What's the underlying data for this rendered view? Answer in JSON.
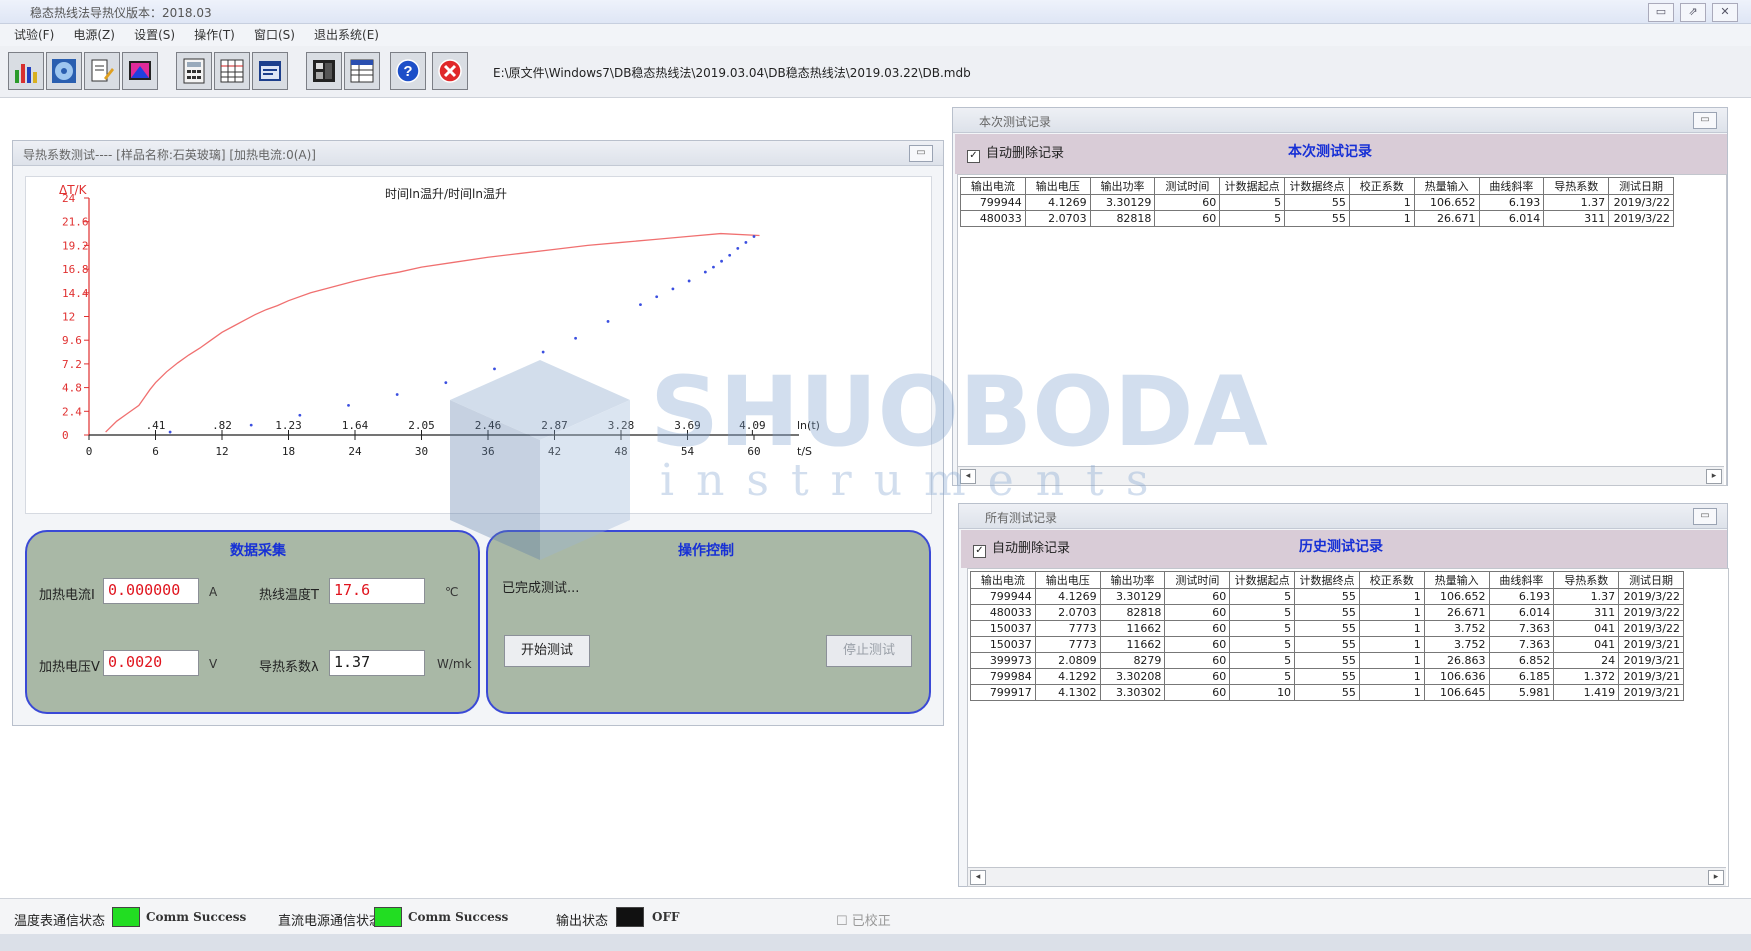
{
  "window": {
    "title": "稳态热线法导热仪版本：2018.03",
    "controls": [
      "▭",
      "⇗",
      "✕"
    ]
  },
  "menu": {
    "items": [
      "试验(F)",
      "电源(Z)",
      "设置(S)",
      "操作(T)",
      "窗口(S)",
      "退出系统(E)"
    ]
  },
  "toolbar": {
    "icons": [
      "chart-bars-icon",
      "disc-icon",
      "edit-report-icon",
      "monitor-icon",
      "calculator-icon",
      "grid-table-icon",
      "data-window-icon",
      "display-panel-icon",
      "table-window-icon",
      "help-icon",
      "close-icon"
    ],
    "path": "E:\\原文件\\Windows7\\DB稳态热线法\\2019.03.04\\DB稳态热线法\\2019.03.22\\DB.mdb",
    "help_label": "?"
  },
  "test_panel": {
    "title": "导热系数测试---- [样品名称:石英玻璃]  [加热电流:0(A)]",
    "chart_title": "时间ln温升/时间ln温升",
    "y_label": "ΔT/K",
    "x_label": "t/S",
    "lnx_label": "ln(t)",
    "collect": {
      "title": "数据采集",
      "current_label": "加热电流I",
      "current_value": "0.000000",
      "current_unit": "A",
      "voltage_label": "加热电压V",
      "voltage_value": "0.0020",
      "voltage_unit": "V",
      "temp_label": "热线温度T",
      "temp_value": "17.6",
      "temp_unit": "℃",
      "cond_label": "导热系数λ",
      "cond_value": "1.37",
      "cond_unit": "W/mk"
    },
    "control": {
      "title": "操作控制",
      "status": "已完成测试...",
      "start_label": "开始测试",
      "stop_label": "停止测试"
    }
  },
  "current_records": {
    "panel_title": "本次测试记录",
    "auto_label": "自动删除记录",
    "check_mark": "✓",
    "title": "本次测试记录",
    "columns": [
      "输出电流",
      "输出电压",
      "输出功率",
      "测试时间",
      "计数据起点",
      "计数据终点",
      "校正系数",
      "热量输入",
      "曲线斜率",
      "导热系数",
      "测试日期"
    ],
    "rows": [
      [
        "799944",
        "4.1269",
        "3.30129",
        "60",
        "5",
        "55",
        "1",
        "106.652",
        "6.193",
        "1.37",
        "2019/3/22"
      ],
      [
        "480033",
        "2.0703",
        "82818",
        "60",
        "5",
        "55",
        "1",
        "26.671",
        "6.014",
        "311",
        "2019/3/22"
      ]
    ]
  },
  "history_records": {
    "panel_title": "所有测试记录",
    "auto_label": "自动删除记录",
    "check_mark": "✓",
    "title": "历史测试记录",
    "columns": [
      "输出电流",
      "输出电压",
      "输出功率",
      "测试时间",
      "计数据起点",
      "计数据终点",
      "校正系数",
      "热量输入",
      "曲线斜率",
      "导热系数",
      "测试日期"
    ],
    "rows": [
      [
        "799944",
        "4.1269",
        "3.30129",
        "60",
        "5",
        "55",
        "1",
        "106.652",
        "6.193",
        "1.37",
        "2019/3/22"
      ],
      [
        "480033",
        "2.0703",
        "82818",
        "60",
        "5",
        "55",
        "1",
        "26.671",
        "6.014",
        "311",
        "2019/3/22"
      ],
      [
        "150037",
        "7773",
        "11662",
        "60",
        "5",
        "55",
        "1",
        "3.752",
        "7.363",
        "041",
        "2019/3/22"
      ],
      [
        "150037",
        "7773",
        "11662",
        "60",
        "5",
        "55",
        "1",
        "3.752",
        "7.363",
        "041",
        "2019/3/21"
      ],
      [
        "399973",
        "2.0809",
        "8279",
        "60",
        "5",
        "55",
        "1",
        "26.863",
        "6.852",
        "24",
        "2019/3/21"
      ],
      [
        "799984",
        "4.1292",
        "3.30208",
        "60",
        "5",
        "55",
        "1",
        "106.636",
        "6.185",
        "1.372",
        "2019/3/21"
      ],
      [
        "799917",
        "4.1302",
        "3.30302",
        "60",
        "10",
        "55",
        "1",
        "106.645",
        "5.981",
        "1.419",
        "2019/3/21"
      ]
    ]
  },
  "statusbar": {
    "temp_comm_label": "温度表通信状态",
    "temp_comm_value": "Comm Success",
    "dc_comm_label": "直流电源通信状态",
    "dc_comm_value": "Comm Success",
    "output_label": "输出状态",
    "output_value": "OFF",
    "checkbox_label": "已校正",
    "check_mark": "☐",
    "colors": {
      "ok": "#22dd22",
      "off": "#111111"
    }
  },
  "watermark": {
    "brand": "SHUOBODA",
    "sub": "instruments"
  },
  "chart_data": {
    "type": "line",
    "title": "时间ln温升/时间ln温升",
    "ylabel": "ΔT/K",
    "xlabel": "t/S",
    "ylim": [
      0,
      24
    ],
    "xlim": [
      0,
      60
    ],
    "y_ticks": [
      "0",
      "2.4",
      "4.8",
      "7.2",
      "9.6",
      "12",
      "14.4",
      "16.8",
      "19.2",
      "21.6",
      "24"
    ],
    "x_ticks": [
      "0",
      "6",
      "12",
      "18",
      "24",
      "30",
      "36",
      "42",
      "48",
      "54",
      "60"
    ],
    "ln_ticks": [
      ".41",
      ".82",
      "1.23",
      "1.64",
      "2.05",
      "2.46",
      "2.87",
      "3.28",
      "3.69",
      "4.09"
    ],
    "ln_values": [
      0.41,
      0.82,
      1.23,
      1.64,
      2.05,
      2.46,
      2.87,
      3.28,
      3.69,
      4.09
    ],
    "lnmax": 4.1,
    "series": [
      {
        "color": "#f07070",
        "x": [
          1.5,
          2.5,
          3.5,
          4.5,
          5,
          5.5,
          6,
          7,
          8,
          9,
          10,
          11,
          12,
          13,
          14,
          15,
          16,
          17,
          18,
          20,
          22,
          24,
          26,
          28,
          30,
          33,
          36,
          39,
          42,
          45,
          48,
          51,
          54,
          57,
          60.5
        ],
        "y": [
          0.3,
          1.4,
          2.2,
          3.0,
          3.8,
          4.6,
          5.3,
          6.4,
          7.3,
          8.1,
          8.8,
          9.6,
          10.4,
          11.0,
          11.6,
          12.2,
          12.7,
          13.1,
          13.6,
          14.4,
          15.0,
          15.6,
          16.1,
          16.5,
          17.0,
          17.5,
          18.0,
          18.4,
          18.8,
          19.2,
          19.5,
          19.8,
          20.1,
          20.4,
          20.2
        ]
      },
      {
        "color": "#3b4fe0",
        "x": [
          0.5,
          1.0,
          1.3,
          1.6,
          1.9,
          2.2,
          2.5,
          2.8,
          3.0,
          3.2,
          3.4,
          3.5,
          3.6,
          3.7,
          3.8,
          3.85,
          3.9,
          3.95,
          4.0,
          4.05,
          4.1
        ],
        "y": [
          0.3,
          1.0,
          2.0,
          3.0,
          4.1,
          5.3,
          6.7,
          8.4,
          9.8,
          11.5,
          13.2,
          14.0,
          14.8,
          15.6,
          16.5,
          17.0,
          17.6,
          18.2,
          18.9,
          19.5,
          20.1
        ]
      }
    ]
  }
}
